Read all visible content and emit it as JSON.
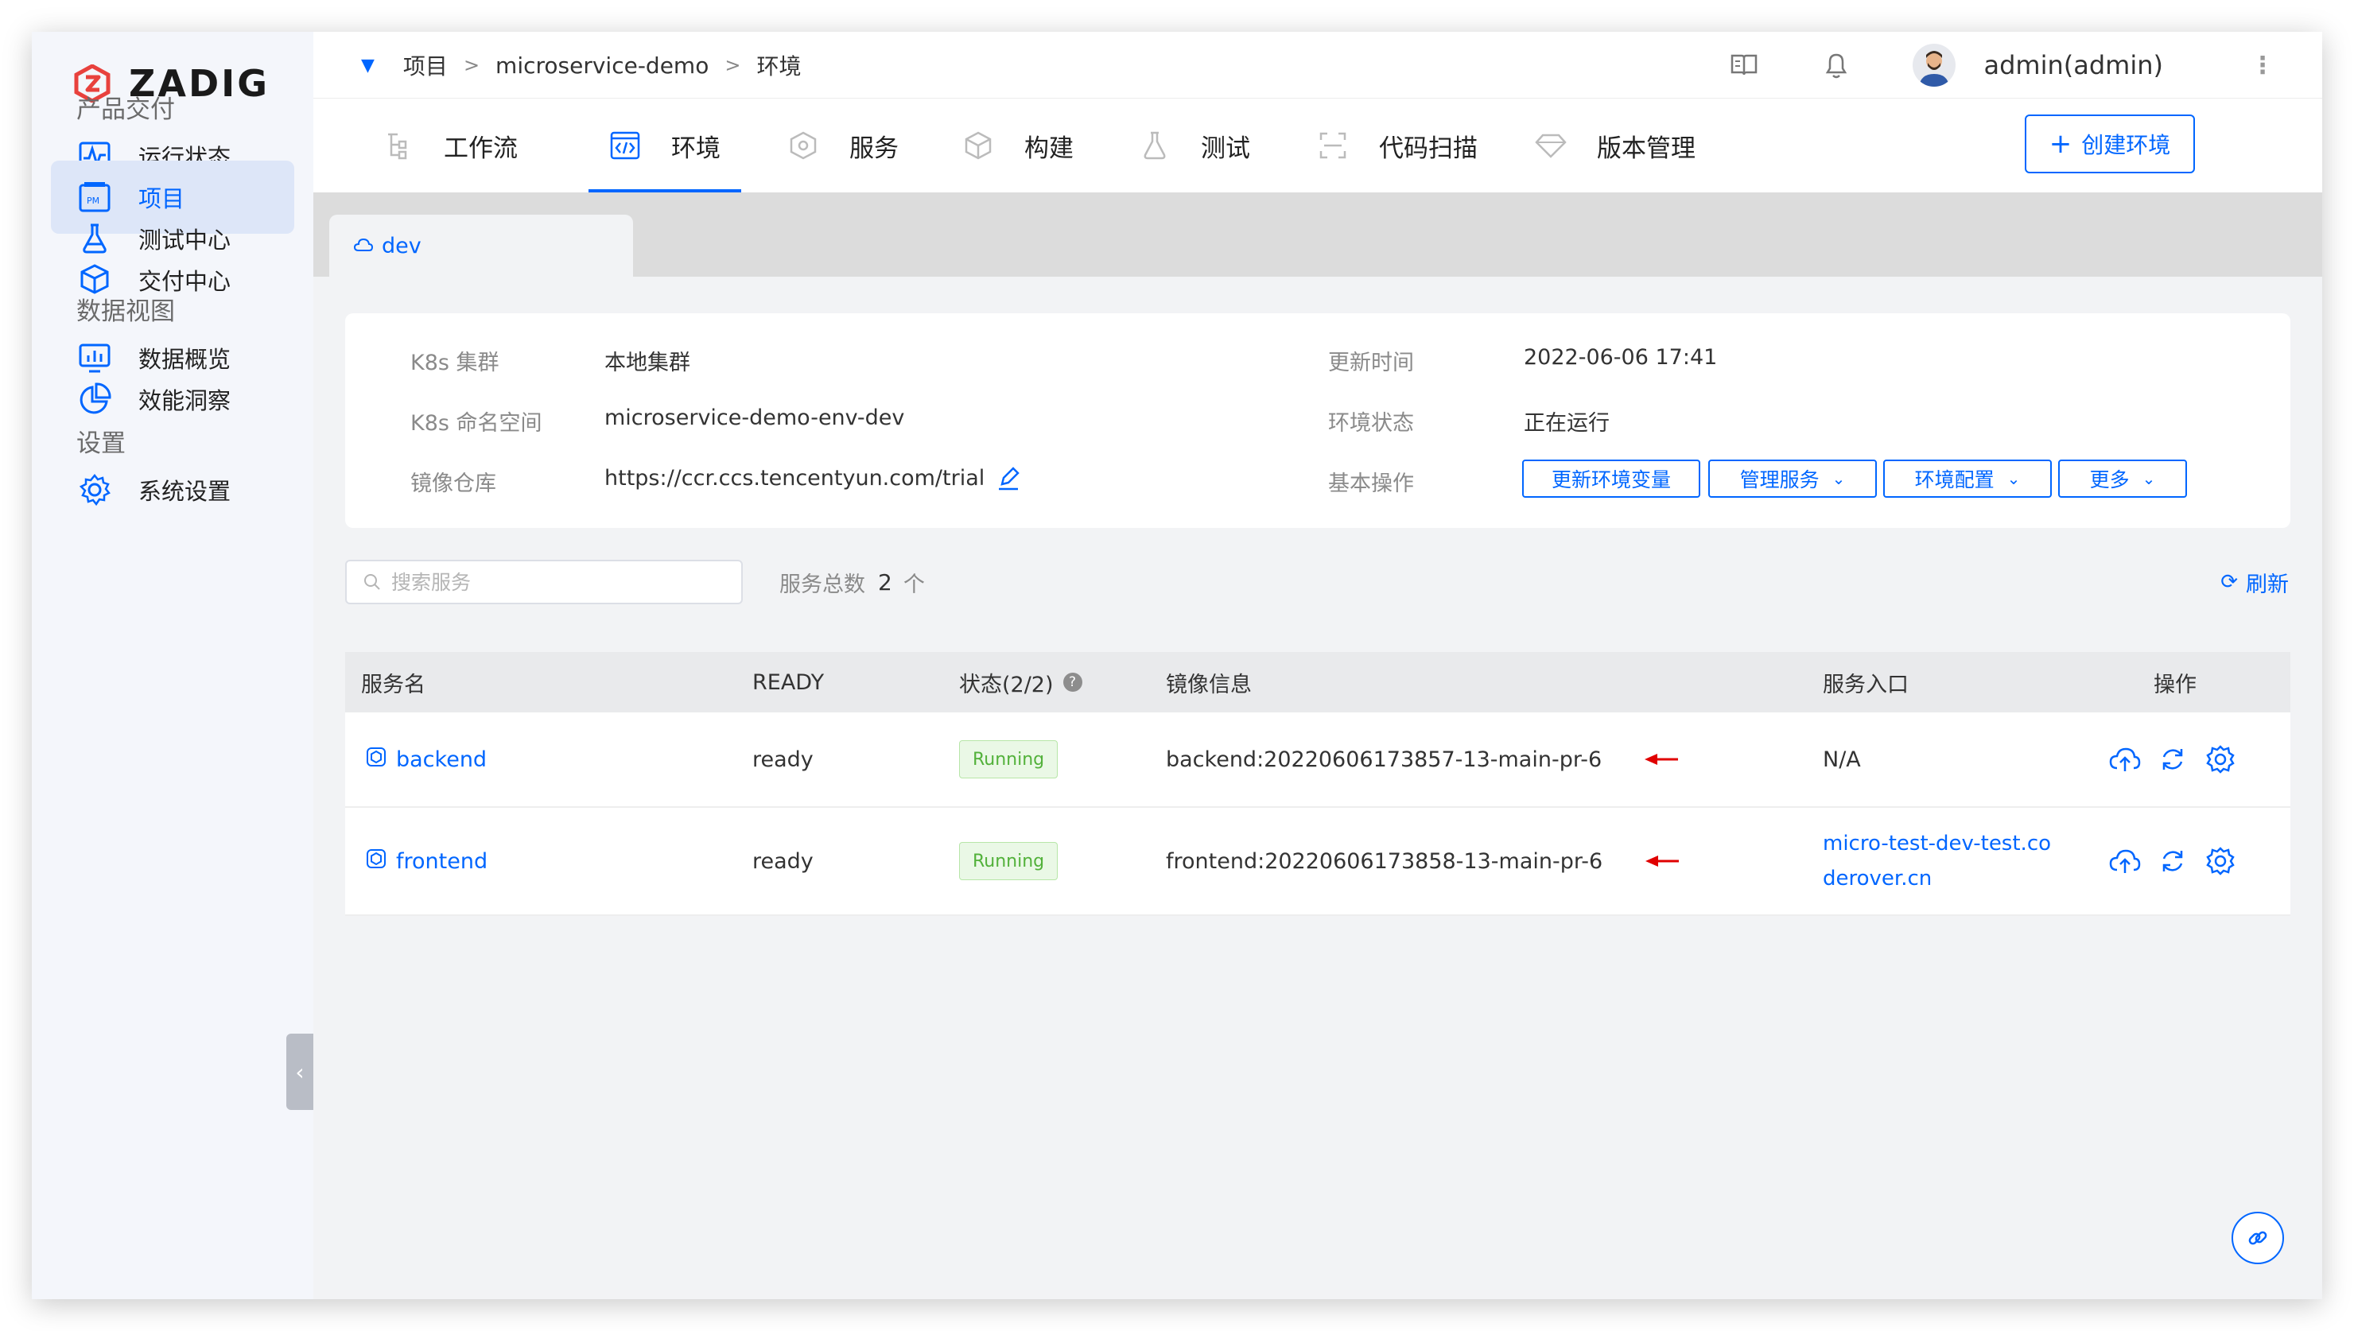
{
  "brand": {
    "name": "ZADIG",
    "accent": "#0066ff",
    "logo_color": "#e8413d"
  },
  "sidebar": {
    "sections": [
      {
        "title": "产品交付",
        "items": [
          {
            "label": "运行状态",
            "icon": "pulse-icon"
          },
          {
            "label": "项目",
            "icon": "pm-icon",
            "active": true
          },
          {
            "label": "测试中心",
            "icon": "flask-icon"
          },
          {
            "label": "交付中心",
            "icon": "cube-icon"
          }
        ]
      },
      {
        "title": "数据视图",
        "items": [
          {
            "label": "数据概览",
            "icon": "monitor-chart-icon"
          },
          {
            "label": "效能洞察",
            "icon": "pie-chart-icon"
          }
        ]
      },
      {
        "title": "设置",
        "items": [
          {
            "label": "系统设置",
            "icon": "gear-icon"
          }
        ]
      }
    ]
  },
  "topbar": {
    "breadcrumb": [
      "项目",
      "microservice-demo",
      "环境"
    ],
    "separator": ">",
    "user": "admin(admin)"
  },
  "tabs": [
    {
      "label": "工作流",
      "icon": "workflow-icon"
    },
    {
      "label": "环境",
      "icon": "code-icon",
      "active": true
    },
    {
      "label": "服务",
      "icon": "hexagon-icon"
    },
    {
      "label": "构建",
      "icon": "box-icon"
    },
    {
      "label": "测试",
      "icon": "beaker-icon"
    },
    {
      "label": "代码扫描",
      "icon": "scan-icon"
    },
    {
      "label": "版本管理",
      "icon": "diamond-icon"
    }
  ],
  "create_env_button": "创建环境",
  "env_tab": "dev",
  "env_info": {
    "cluster_label": "K8s 集群",
    "cluster_value": "本地集群",
    "namespace_label": "K8s 命名空间",
    "namespace_value": "microservice-demo-env-dev",
    "registry_label": "镜像仓库",
    "registry_value": "https://ccr.ccs.tencentyun.com/trial",
    "updated_label": "更新时间",
    "updated_value": "2022-06-06 17:41",
    "status_label": "环境状态",
    "status_value": "正在运行",
    "ops_label": "基本操作",
    "ops": [
      "更新环境变量",
      "管理服务",
      "环境配置",
      "更多"
    ]
  },
  "search": {
    "placeholder": "搜索服务"
  },
  "service_count": {
    "label": "服务总数",
    "value": "2",
    "unit": "个"
  },
  "refresh_label": "刷新",
  "table": {
    "headers": [
      "服务名",
      "READY",
      "状态(2/2)",
      "镜像信息",
      "服务入口",
      "操作"
    ],
    "rows": [
      {
        "name": "backend",
        "ready": "ready",
        "status": "Running",
        "image": "backend:20220606173857-13-main-pr-6",
        "entry": "N/A"
      },
      {
        "name": "frontend",
        "ready": "ready",
        "status": "Running",
        "image": "frontend:20220606173858-13-main-pr-6",
        "entry": "micro-test-dev-test.coderover.cn"
      }
    ]
  }
}
